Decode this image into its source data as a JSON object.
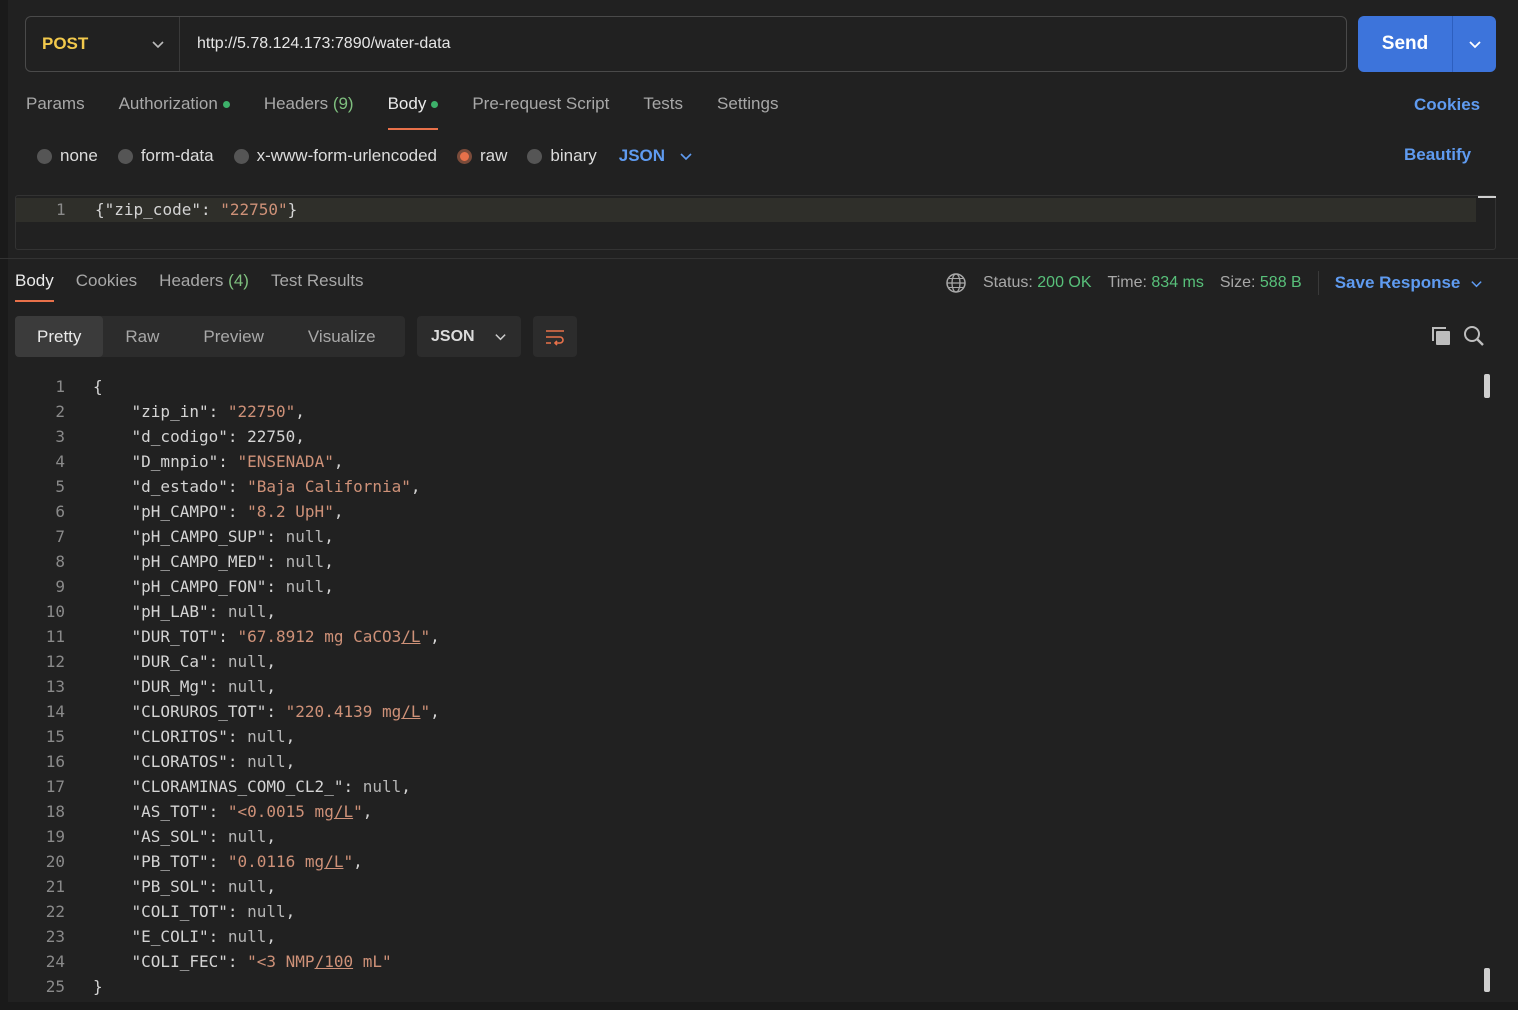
{
  "request": {
    "method": "POST",
    "url": "http://5.78.124.173:7890/water-data",
    "send_label": "Send"
  },
  "request_tabs": {
    "params": "Params",
    "authorization": "Authorization",
    "headers": "Headers",
    "headers_count": "(9)",
    "body": "Body",
    "pre_request": "Pre-request Script",
    "tests": "Tests",
    "settings": "Settings",
    "cookies": "Cookies"
  },
  "body_types": {
    "none": "none",
    "form_data": "form-data",
    "urlencoded": "x-www-form-urlencoded",
    "raw": "raw",
    "binary": "binary",
    "selected_format": "JSON",
    "beautify": "Beautify"
  },
  "request_body": {
    "line_number": "1",
    "key": "\"zip_code\"",
    "value": "\"22750\""
  },
  "response_tabs": {
    "body": "Body",
    "cookies": "Cookies",
    "headers": "Headers",
    "headers_count": "(4)",
    "test_results": "Test Results"
  },
  "response_status": {
    "status_label": "Status:",
    "status_value": "200 OK",
    "time_label": "Time:",
    "time_value": "834 ms",
    "size_label": "Size:",
    "size_value": "588 B",
    "save_response": "Save Response"
  },
  "view_modes": {
    "pretty": "Pretty",
    "raw": "Raw",
    "preview": "Preview",
    "visualize": "Visualize",
    "format": "JSON"
  },
  "response_lines": [
    {
      "n": "1",
      "key": "",
      "val": "{",
      "type": "brace"
    },
    {
      "n": "2",
      "key": "\"zip_in\"",
      "val": "\"22750\"",
      "type": "string",
      "comma": true
    },
    {
      "n": "3",
      "key": "\"d_codigo\"",
      "val": "22750",
      "type": "number",
      "comma": true
    },
    {
      "n": "4",
      "key": "\"D_mnpio\"",
      "val": "\"ENSENADA\"",
      "type": "string",
      "comma": true
    },
    {
      "n": "5",
      "key": "\"d_estado\"",
      "val": "\"Baja California\"",
      "type": "string",
      "comma": true
    },
    {
      "n": "6",
      "key": "\"pH_CAMPO\"",
      "val": "\"8.2 UpH\"",
      "type": "string",
      "comma": true
    },
    {
      "n": "7",
      "key": "\"pH_CAMPO_SUP\"",
      "val": "null",
      "type": "null",
      "comma": true
    },
    {
      "n": "8",
      "key": "\"pH_CAMPO_MED\"",
      "val": "null",
      "type": "null",
      "comma": true
    },
    {
      "n": "9",
      "key": "\"pH_CAMPO_FON\"",
      "val": "null",
      "type": "null",
      "comma": true
    },
    {
      "n": "10",
      "key": "\"pH_LAB\"",
      "val": "null",
      "type": "null",
      "comma": true
    },
    {
      "n": "11",
      "key": "\"DUR_TOT\"",
      "val": "\"67.8912 mg CaCO3/L\"",
      "type": "string",
      "comma": true
    },
    {
      "n": "12",
      "key": "\"DUR_Ca\"",
      "val": "null",
      "type": "null",
      "comma": true
    },
    {
      "n": "13",
      "key": "\"DUR_Mg\"",
      "val": "null",
      "type": "null",
      "comma": true
    },
    {
      "n": "14",
      "key": "\"CLORUROS_TOT\"",
      "val": "\"220.4139 mg/L\"",
      "type": "string",
      "comma": true
    },
    {
      "n": "15",
      "key": "\"CLORITOS\"",
      "val": "null",
      "type": "null",
      "comma": true
    },
    {
      "n": "16",
      "key": "\"CLORATOS\"",
      "val": "null",
      "type": "null",
      "comma": true
    },
    {
      "n": "17",
      "key": "\"CLORAMINAS_COMO_CL2_\"",
      "val": "null",
      "type": "null",
      "comma": true
    },
    {
      "n": "18",
      "key": "\"AS_TOT\"",
      "val": "\"<0.0015 mg/L\"",
      "type": "string",
      "comma": true
    },
    {
      "n": "19",
      "key": "\"AS_SOL\"",
      "val": "null",
      "type": "null",
      "comma": true
    },
    {
      "n": "20",
      "key": "\"PB_TOT\"",
      "val": "\"0.0116 mg/L\"",
      "type": "string",
      "comma": true
    },
    {
      "n": "21",
      "key": "\"PB_SOL\"",
      "val": "null",
      "type": "null",
      "comma": true
    },
    {
      "n": "22",
      "key": "\"COLI_TOT\"",
      "val": "null",
      "type": "null",
      "comma": true
    },
    {
      "n": "23",
      "key": "\"E_COLI\"",
      "val": "null",
      "type": "null",
      "comma": true
    },
    {
      "n": "24",
      "key": "\"COLI_FEC\"",
      "val": "\"<3 NMP/100 mL\"",
      "type": "string",
      "comma": false
    },
    {
      "n": "25",
      "key": "",
      "val": "}",
      "type": "brace"
    }
  ],
  "colors": {
    "accent": "#e8714a",
    "send": "#3d74db",
    "link": "#5f9bf0",
    "method": "#f2c94c",
    "status_ok": "#58c07a",
    "string": "#ce9178"
  }
}
